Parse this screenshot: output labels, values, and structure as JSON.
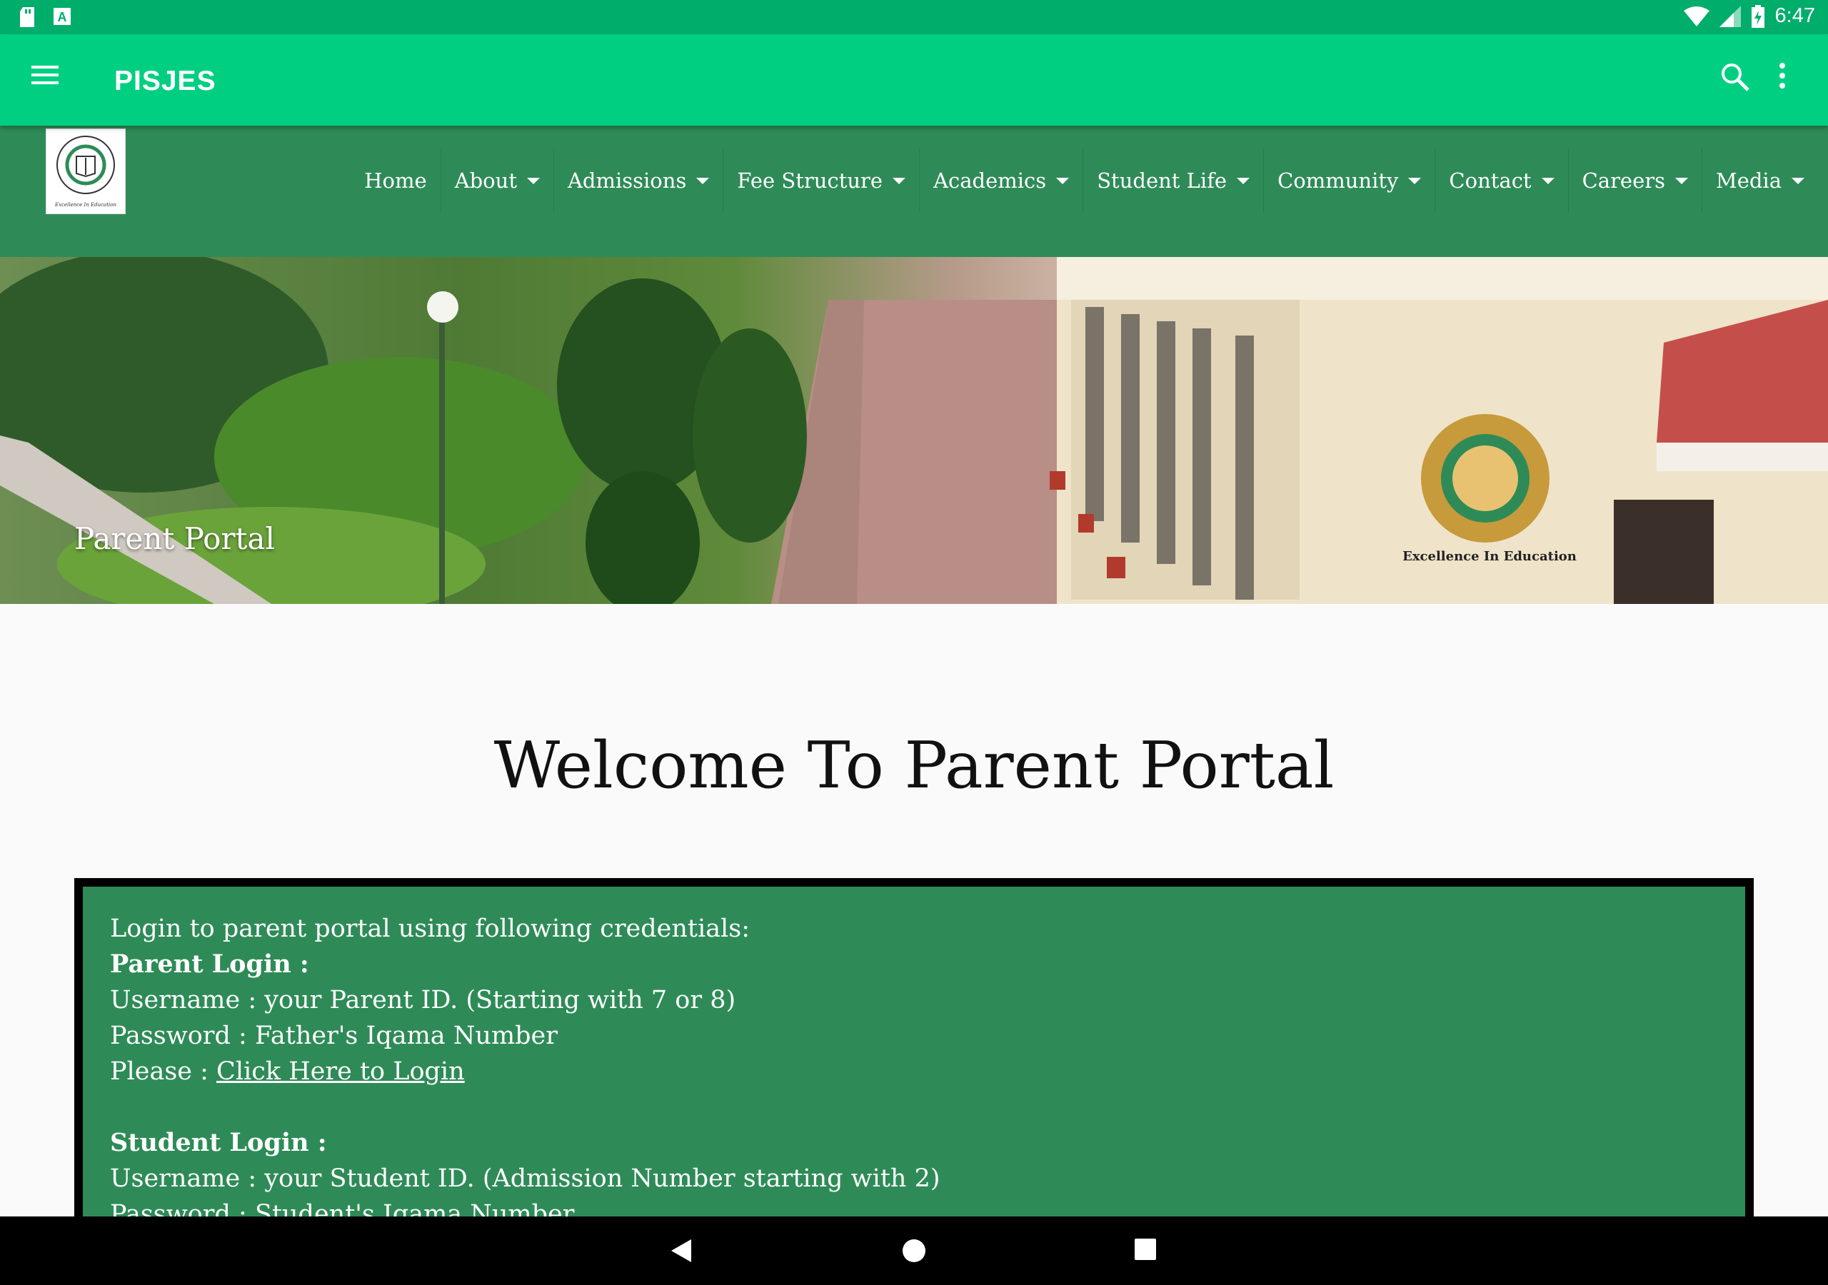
{
  "status_bar": {
    "time": "6:47",
    "icons": [
      "sd-card-icon",
      "a-notification-icon",
      "wifi-icon",
      "signal-icon",
      "battery-icon"
    ]
  },
  "app_bar": {
    "title": "PISJES",
    "icons": [
      "hamburger-menu-icon",
      "search-icon",
      "more-vert-icon"
    ]
  },
  "site_header": {
    "logo_text": "Excellence In Education",
    "nav": [
      {
        "label": "Home",
        "dropdown": false
      },
      {
        "label": "About",
        "dropdown": true
      },
      {
        "label": "Admissions",
        "dropdown": true
      },
      {
        "label": "Fee Structure",
        "dropdown": true
      },
      {
        "label": "Academics",
        "dropdown": true
      },
      {
        "label": "Student Life",
        "dropdown": true
      },
      {
        "label": "Community",
        "dropdown": true
      },
      {
        "label": "Contact",
        "dropdown": true
      },
      {
        "label": "Careers",
        "dropdown": true
      },
      {
        "label": "Media",
        "dropdown": true
      }
    ]
  },
  "hero": {
    "caption": "Parent Portal",
    "seal_text": "Excellence In Education"
  },
  "main": {
    "heading": "Welcome To Parent Portal",
    "intro": "Login to parent portal using following credentials:",
    "parent_login_title": "Parent Login :",
    "parent_username": "Username : your Parent ID. (Starting with 7 or 8)",
    "parent_password": "Password : Father's Iqama Number",
    "please_label": "Please : ",
    "login_link": "Click Here to Login ",
    "student_login_title": "Student Login :",
    "student_username": "Username : your Student ID. (Admission Number starting with 2)",
    "student_password": "Password : Student's Iqama Number"
  },
  "colors": {
    "status_bar": "#00ad6b",
    "app_bar": "#00cf82",
    "header_green": "#2e8b57",
    "box_border": "#000000"
  }
}
